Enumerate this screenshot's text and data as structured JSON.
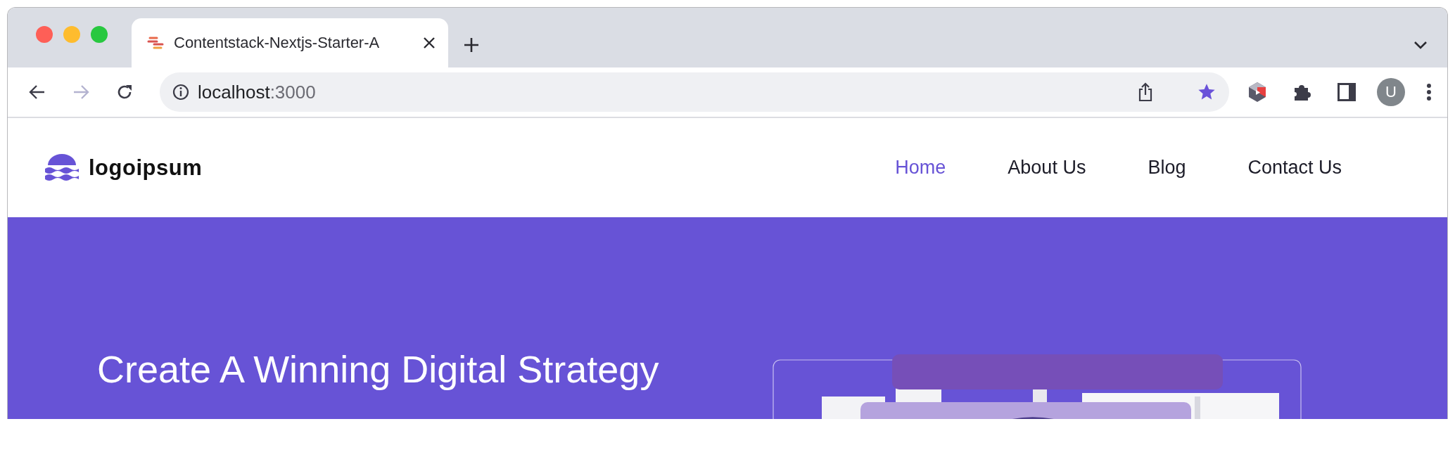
{
  "browser": {
    "tab": {
      "title": "Contentstack-Nextjs-Starter-A"
    },
    "address": {
      "host": "localhost",
      "port": ":3000"
    },
    "bookmarked": true,
    "profile_initial": "U"
  },
  "site": {
    "logo": "logoipsum",
    "nav": [
      {
        "label": "Home",
        "selected": true
      },
      {
        "label": "About Us",
        "selected": false
      },
      {
        "label": "Blog",
        "selected": false
      },
      {
        "label": "Contact Us",
        "selected": false
      }
    ]
  },
  "hero": {
    "heading": "Create A Winning Digital Strategy"
  }
}
